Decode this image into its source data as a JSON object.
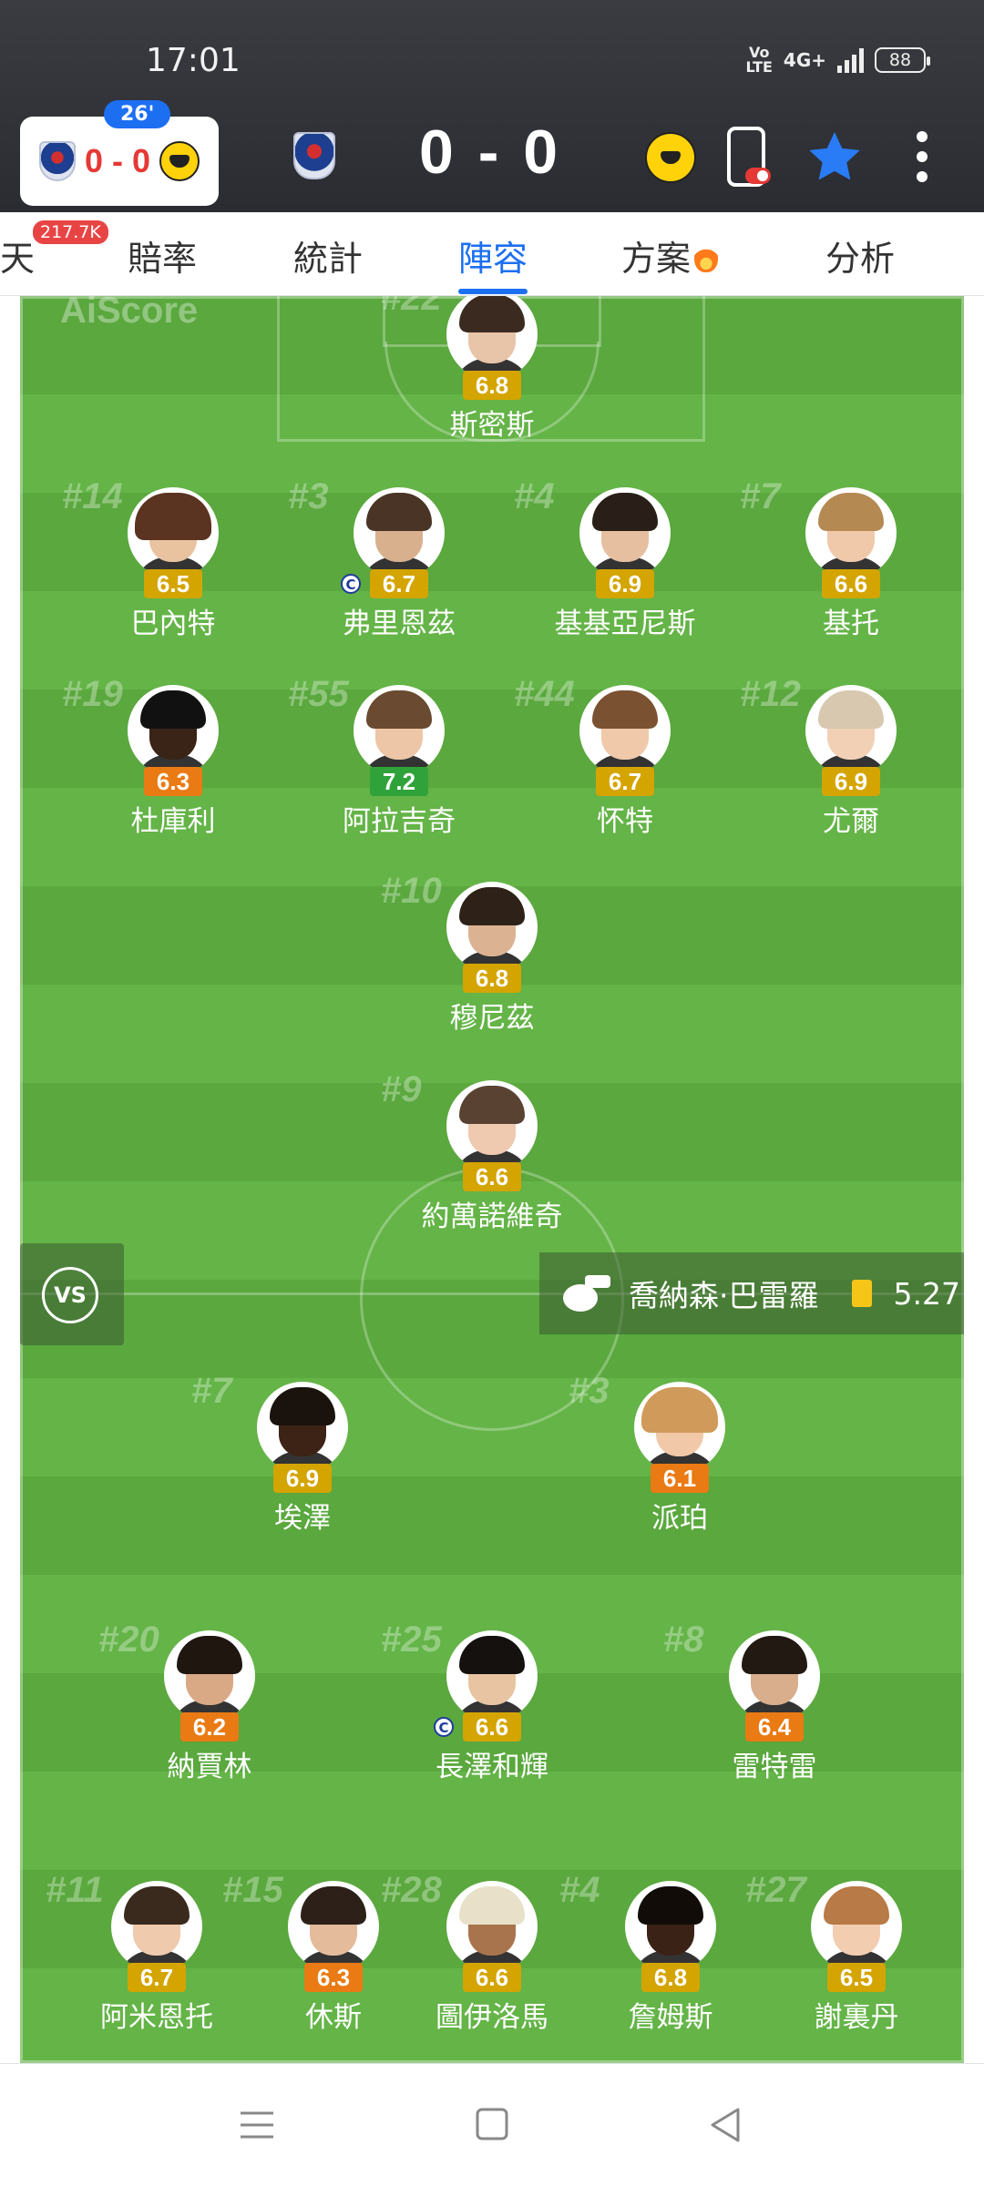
{
  "status_bar": {
    "time": "17:01",
    "volte": "Vo\nLTE",
    "network": "4G+",
    "battery": "88"
  },
  "match": {
    "minute": "26'",
    "mini_score": "0 - 0",
    "score": "0 - 0",
    "home_team": "Adelaide United",
    "away_team": "Wellington Phoenix"
  },
  "tabs": {
    "items": [
      {
        "label": "天"
      },
      {
        "label": "賠率"
      },
      {
        "label": "統計"
      },
      {
        "label": "陣容"
      },
      {
        "label": "方案"
      },
      {
        "label": "分析"
      }
    ],
    "active_index": 3,
    "chat_badge": "217.7K"
  },
  "pitch": {
    "watermark": "AiScore",
    "vs_label": "VS",
    "referee": {
      "name": "喬納森·巴雷羅",
      "card": "yellow",
      "value": "5.27"
    }
  },
  "colors": {
    "rating_yellow": "#d4a400",
    "rating_orange": "#ea7a13",
    "rating_green": "#2fa33a",
    "accent": "#1d6ff2"
  },
  "players": [
    {
      "num": "#22",
      "rating": "6.8",
      "tier": "yellow",
      "name": "斯密斯",
      "captain": false
    },
    {
      "num": "#14",
      "rating": "6.5",
      "tier": "yellow",
      "name": "巴內特",
      "captain": false
    },
    {
      "num": "#3",
      "rating": "6.7",
      "tier": "yellow",
      "name": "弗里恩茲",
      "captain": true
    },
    {
      "num": "#4",
      "rating": "6.9",
      "tier": "yellow",
      "name": "基基亞尼斯",
      "captain": false
    },
    {
      "num": "#7",
      "rating": "6.6",
      "tier": "yellow",
      "name": "基托",
      "captain": false
    },
    {
      "num": "#19",
      "rating": "6.3",
      "tier": "orange",
      "name": "杜庫利",
      "captain": false
    },
    {
      "num": "#55",
      "rating": "7.2",
      "tier": "green",
      "name": "阿拉吉奇",
      "captain": false
    },
    {
      "num": "#44",
      "rating": "6.7",
      "tier": "yellow",
      "name": "怀特",
      "captain": false
    },
    {
      "num": "#12",
      "rating": "6.9",
      "tier": "yellow",
      "name": "尤爾",
      "captain": false
    },
    {
      "num": "#10",
      "rating": "6.8",
      "tier": "yellow",
      "name": "穆尼茲",
      "captain": false
    },
    {
      "num": "#9",
      "rating": "6.6",
      "tier": "yellow",
      "name": "約萬諾維奇",
      "captain": false
    },
    {
      "num": "#7",
      "rating": "6.9",
      "tier": "yellow",
      "name": "埃澤",
      "captain": false
    },
    {
      "num": "#3",
      "rating": "6.1",
      "tier": "orange",
      "name": "派珀",
      "captain": false
    },
    {
      "num": "#20",
      "rating": "6.2",
      "tier": "orange",
      "name": "納賈林",
      "captain": false
    },
    {
      "num": "#25",
      "rating": "6.6",
      "tier": "yellow",
      "name": "長澤和輝",
      "captain": true
    },
    {
      "num": "#8",
      "rating": "6.4",
      "tier": "orange",
      "name": "雷特雷",
      "captain": false
    },
    {
      "num": "#11",
      "rating": "6.7",
      "tier": "yellow",
      "name": "阿米恩托",
      "captain": false
    },
    {
      "num": "#15",
      "rating": "6.3",
      "tier": "orange",
      "name": "休斯",
      "captain": false
    },
    {
      "num": "#28",
      "rating": "6.6",
      "tier": "yellow",
      "name": "圖伊洛馬",
      "captain": false
    },
    {
      "num": "#4",
      "rating": "6.8",
      "tier": "yellow",
      "name": "詹姆斯",
      "captain": false
    },
    {
      "num": "#27",
      "rating": "6.5",
      "tier": "yellow",
      "name": "謝裏丹",
      "captain": false
    }
  ]
}
